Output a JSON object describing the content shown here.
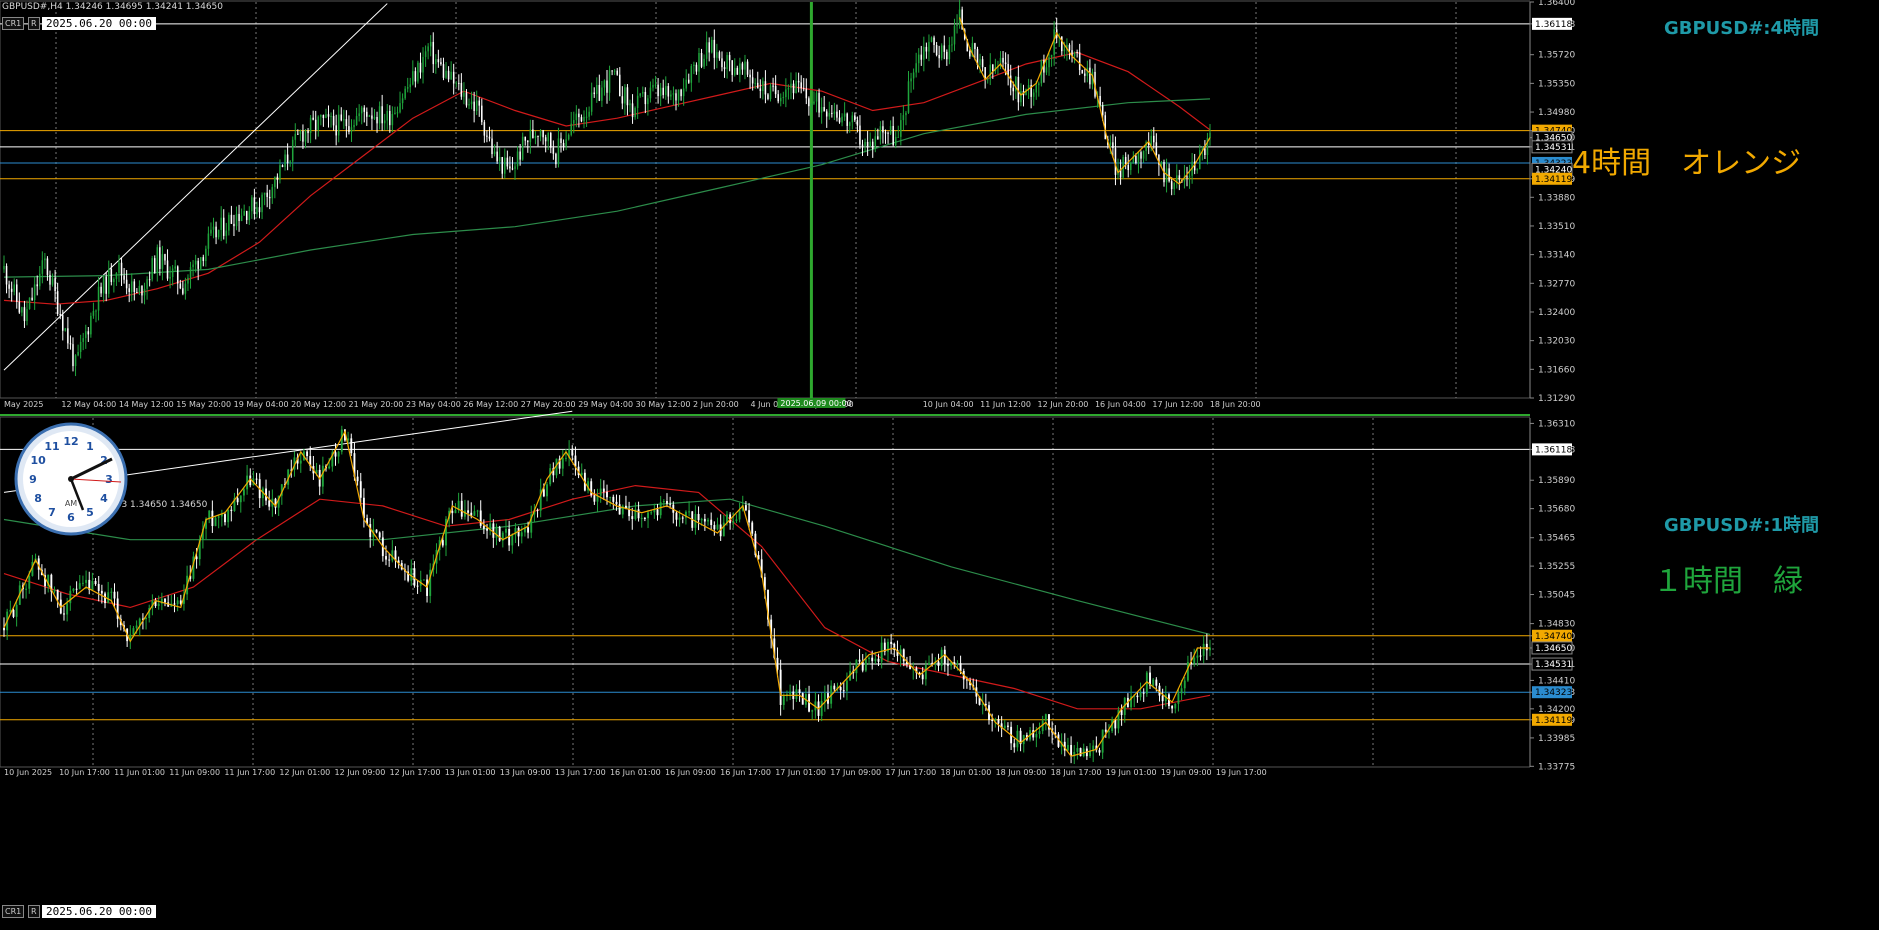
{
  "colors": {
    "background": "#000000",
    "bull": "#1fa53c",
    "bear": "#ffffff",
    "ma_fast": "#d11a1a",
    "ma_slow": "#2c8c4a",
    "zigzag": "#f2a900",
    "orange_level": "#f2a900",
    "blue_level": "#2b8ccf",
    "white_level": "#ffffff",
    "vline_green": "#2ea82e",
    "title": "#1f9aa8"
  },
  "header": {
    "symbol_line": "GBPUSD#,H4  1.34246 1.34695 1.34241 1.34650",
    "symbol_line_bottom": "683 1.34650 1.34650"
  },
  "toolbar": {
    "cr_label": "CR1",
    "r_label": "R",
    "date_value": "2025.06.20 00:00"
  },
  "notes": {
    "h4_note": "4時間　オレンジ",
    "h1_note": "１時間　緑"
  },
  "clock": {
    "am_label": "AM",
    "numbers": [
      "12",
      "1",
      "2",
      "3",
      "4",
      "5",
      "6",
      "7",
      "8",
      "9",
      "10",
      "11"
    ]
  },
  "chart_data": [
    {
      "type": "candlestick",
      "title": "GBPUSD#:4時間",
      "timeframe": "H4",
      "ylim": [
        1.3129,
        1.364
      ],
      "y_ticks": [
        1.364,
        1.36118,
        1.3572,
        1.3535,
        1.3498,
        1.3474,
        1.3465,
        1.34531,
        1.34119,
        1.3388,
        1.3351,
        1.3314,
        1.3277,
        1.324,
        1.3203,
        1.3166,
        1.3129
      ],
      "x_ticks": [
        "May 2025",
        "12 May 04:00",
        "14 May 12:00",
        "15 May 20:00",
        "19 May 04:00",
        "20 May 12:00",
        "21 May 20:00",
        "23 May 04:00",
        "26 May 12:00",
        "27 May 20:00",
        "29 May 04:00",
        "30 May 12:00",
        "2 Jun 20:00",
        "4 Jun 04:00",
        "5 Jun 12:00",
        "2025.06.09 00:00",
        "10 Jun 04:00",
        "11 Jun 12:00",
        "12 Jun 20:00",
        "16 Jun 04:00",
        "17 Jun 12:00",
        "18 Jun 20:00"
      ],
      "horizontal_lines": [
        {
          "price": 1.36118,
          "color": "white"
        },
        {
          "price": 1.3474,
          "color": "orange"
        },
        {
          "price": 1.34531,
          "color": "white"
        },
        {
          "price": 1.34323,
          "color": "blue"
        },
        {
          "price": 1.34119,
          "color": "orange"
        }
      ],
      "price_tags": [
        {
          "label": "1.36118",
          "kind": "white"
        },
        {
          "label": "1.34740",
          "kind": "orange"
        },
        {
          "label": "1.34650",
          "kind": "plain"
        },
        {
          "label": "1.34531",
          "kind": "plain"
        },
        {
          "label": "1.34323",
          "kind": "blue"
        },
        {
          "label": "1.34240",
          "kind": "plain"
        },
        {
          "label": "1.34119",
          "kind": "orange"
        }
      ],
      "vertical_marker": "2025.06.09 00:00",
      "trendline": {
        "from": {
          "bar": 0,
          "price": 1.3165
        },
        "to": {
          "bar": 150,
          "price": 1.3638
        }
      },
      "close_path": [
        [
          0,
          1.3295
        ],
        [
          8,
          1.323
        ],
        [
          16,
          1.3305
        ],
        [
          22,
          1.324
        ],
        [
          28,
          1.317
        ],
        [
          36,
          1.3255
        ],
        [
          44,
          1.33
        ],
        [
          52,
          1.326
        ],
        [
          60,
          1.331
        ],
        [
          70,
          1.3275
        ],
        [
          80,
          1.333
        ],
        [
          90,
          1.3365
        ],
        [
          100,
          1.338
        ],
        [
          108,
          1.342
        ],
        [
          116,
          1.347
        ],
        [
          124,
          1.3485
        ],
        [
          132,
          1.348
        ],
        [
          142,
          1.35
        ],
        [
          150,
          1.349
        ],
        [
          160,
          1.354
        ],
        [
          166,
          1.358
        ],
        [
          172,
          1.355
        ],
        [
          180,
          1.352
        ],
        [
          186,
          1.35
        ],
        [
          192,
          1.344
        ],
        [
          198,
          1.342
        ],
        [
          204,
          1.346
        ],
        [
          210,
          1.348
        ],
        [
          216,
          1.3445
        ],
        [
          222,
          1.348
        ],
        [
          230,
          1.351
        ],
        [
          238,
          1.3545
        ],
        [
          246,
          1.35
        ],
        [
          254,
          1.3525
        ],
        [
          262,
          1.3515
        ],
        [
          270,
          1.356
        ],
        [
          276,
          1.358
        ],
        [
          284,
          1.356
        ],
        [
          292,
          1.3545
        ],
        [
          300,
          1.352
        ],
        [
          308,
          1.3535
        ],
        [
          316,
          1.351
        ],
        [
          324,
          1.3505
        ],
        [
          332,
          1.348
        ],
        [
          338,
          1.345
        ],
        [
          344,
          1.348
        ],
        [
          350,
          1.346
        ],
        [
          356,
          1.356
        ],
        [
          362,
          1.359
        ],
        [
          368,
          1.357
        ],
        [
          374,
          1.362
        ],
        [
          378,
          1.358
        ],
        [
          384,
          1.354
        ],
        [
          390,
          1.356
        ],
        [
          398,
          1.352
        ],
        [
          404,
          1.3535
        ],
        [
          412,
          1.36
        ],
        [
          418,
          1.357
        ],
        [
          426,
          1.3545
        ],
        [
          432,
          1.346
        ],
        [
          436,
          1.342
        ],
        [
          442,
          1.344
        ],
        [
          448,
          1.346
        ],
        [
          454,
          1.342
        ],
        [
          460,
          1.3405
        ],
        [
          466,
          1.343
        ],
        [
          472,
          1.3465
        ]
      ],
      "series": [
        {
          "name": "MA fast",
          "color": "ma_fast",
          "points": [
            [
              0,
              1.3255
            ],
            [
              20,
              1.325
            ],
            [
              40,
              1.3255
            ],
            [
              60,
              1.327
            ],
            [
              80,
              1.329
            ],
            [
              100,
              1.333
            ],
            [
              120,
              1.339
            ],
            [
              140,
              1.344
            ],
            [
              160,
              1.349
            ],
            [
              180,
              1.3525
            ],
            [
              200,
              1.35
            ],
            [
              220,
              1.348
            ],
            [
              240,
              1.349
            ],
            [
              260,
              1.3505
            ],
            [
              280,
              1.352
            ],
            [
              300,
              1.3535
            ],
            [
              320,
              1.3525
            ],
            [
              340,
              1.35
            ],
            [
              360,
              1.351
            ],
            [
              380,
              1.3535
            ],
            [
              400,
              1.356
            ],
            [
              420,
              1.3575
            ],
            [
              440,
              1.355
            ],
            [
              460,
              1.3505
            ],
            [
              472,
              1.3475
            ]
          ]
        },
        {
          "name": "MA slow",
          "color": "ma_slow",
          "points": [
            [
              0,
              1.3285
            ],
            [
              40,
              1.3287
            ],
            [
              80,
              1.3295
            ],
            [
              120,
              1.332
            ],
            [
              160,
              1.334
            ],
            [
              200,
              1.335
            ],
            [
              240,
              1.337
            ],
            [
              280,
              1.34
            ],
            [
              320,
              1.343
            ],
            [
              360,
              1.347
            ],
            [
              400,
              1.3495
            ],
            [
              440,
              1.351
            ],
            [
              472,
              1.3515
            ]
          ]
        }
      ]
    },
    {
      "type": "candlestick",
      "title": "GBPUSD#:1時間",
      "timeframe": "H1",
      "ylim": [
        1.3377,
        1.3635
      ],
      "y_ticks": [
        1.3631,
        1.36118,
        1.3589,
        1.3568,
        1.35465,
        1.35255,
        1.35045,
        1.3483,
        1.3474,
        1.3465,
        1.34531,
        1.3441,
        1.34323,
        1.342,
        1.34119,
        1.33985,
        1.33775
      ],
      "x_ticks": [
        "10 Jun 2025",
        "10 Jun 17:00",
        "11 Jun 01:00",
        "11 Jun 09:00",
        "11 Jun 17:00",
        "12 Jun 01:00",
        "12 Jun 09:00",
        "12 Jun 17:00",
        "13 Jun 01:00",
        "13 Jun 09:00",
        "13 Jun 17:00",
        "16 Jun 01:00",
        "16 Jun 09:00",
        "16 Jun 17:00",
        "17 Jun 01:00",
        "17 Jun 09:00",
        "17 Jun 17:00",
        "18 Jun 01:00",
        "18 Jun 09:00",
        "18 Jun 17:00",
        "19 Jun 01:00",
        "19 Jun 09:00",
        "19 Jun 17:00"
      ],
      "horizontal_lines": [
        {
          "price": 1.36118,
          "color": "white"
        },
        {
          "price": 1.3474,
          "color": "orange"
        },
        {
          "price": 1.34531,
          "color": "white"
        },
        {
          "price": 1.34323,
          "color": "blue"
        },
        {
          "price": 1.34119,
          "color": "orange"
        }
      ],
      "price_tags": [
        {
          "label": "1.36118",
          "kind": "white"
        },
        {
          "label": "1.34740",
          "kind": "orange"
        },
        {
          "label": "1.34650",
          "kind": "plain"
        },
        {
          "label": "1.34531",
          "kind": "plain"
        },
        {
          "label": "1.34323",
          "kind": "blue"
        },
        {
          "label": "1.34119",
          "kind": "orange"
        }
      ],
      "trendline": {
        "from": {
          "bar": 0,
          "price": 1.358
        },
        "to": {
          "bar": 180,
          "price": 1.364
        }
      },
      "close_path": [
        [
          0,
          1.348
        ],
        [
          10,
          1.353
        ],
        [
          18,
          1.3495
        ],
        [
          26,
          1.351
        ],
        [
          34,
          1.35
        ],
        [
          40,
          1.347
        ],
        [
          48,
          1.35
        ],
        [
          56,
          1.3495
        ],
        [
          64,
          1.356
        ],
        [
          70,
          1.3565
        ],
        [
          78,
          1.359
        ],
        [
          86,
          1.357
        ],
        [
          94,
          1.361
        ],
        [
          100,
          1.359
        ],
        [
          108,
          1.3625
        ],
        [
          114,
          1.356
        ],
        [
          120,
          1.354
        ],
        [
          128,
          1.352
        ],
        [
          134,
          1.351
        ],
        [
          142,
          1.357
        ],
        [
          150,
          1.356
        ],
        [
          158,
          1.3545
        ],
        [
          166,
          1.3555
        ],
        [
          172,
          1.359
        ],
        [
          178,
          1.361
        ],
        [
          186,
          1.358
        ],
        [
          194,
          1.357
        ],
        [
          202,
          1.3565
        ],
        [
          210,
          1.357
        ],
        [
          218,
          1.356
        ],
        [
          226,
          1.355
        ],
        [
          234,
          1.357
        ],
        [
          240,
          1.352
        ],
        [
          246,
          1.343
        ],
        [
          252,
          1.343
        ],
        [
          258,
          1.342
        ],
        [
          266,
          1.344
        ],
        [
          274,
          1.346
        ],
        [
          282,
          1.3465
        ],
        [
          290,
          1.3445
        ],
        [
          298,
          1.346
        ],
        [
          306,
          1.344
        ],
        [
          314,
          1.341
        ],
        [
          322,
          1.3395
        ],
        [
          330,
          1.341
        ],
        [
          338,
          1.3385
        ],
        [
          346,
          1.339
        ],
        [
          354,
          1.342
        ],
        [
          362,
          1.344
        ],
        [
          370,
          1.3425
        ],
        [
          378,
          1.3465
        ],
        [
          382,
          1.3465
        ]
      ],
      "series": [
        {
          "name": "MA fast",
          "color": "ma_fast",
          "points": [
            [
              0,
              1.352
            ],
            [
              20,
              1.3505
            ],
            [
              40,
              1.3495
            ],
            [
              60,
              1.351
            ],
            [
              80,
              1.3545
            ],
            [
              100,
              1.3575
            ],
            [
              120,
              1.357
            ],
            [
              140,
              1.3555
            ],
            [
              160,
              1.356
            ],
            [
              180,
              1.3575
            ],
            [
              200,
              1.3585
            ],
            [
              220,
              1.358
            ],
            [
              240,
              1.354
            ],
            [
              260,
              1.348
            ],
            [
              280,
              1.3455
            ],
            [
              300,
              1.3445
            ],
            [
              320,
              1.3435
            ],
            [
              340,
              1.342
            ],
            [
              360,
              1.342
            ],
            [
              382,
              1.343
            ]
          ]
        },
        {
          "name": "MA slow",
          "color": "ma_slow",
          "points": [
            [
              0,
              1.356
            ],
            [
              40,
              1.3545
            ],
            [
              80,
              1.3545
            ],
            [
              120,
              1.3545
            ],
            [
              160,
              1.3555
            ],
            [
              200,
              1.357
            ],
            [
              230,
              1.3575
            ],
            [
              260,
              1.3555
            ],
            [
              300,
              1.3525
            ],
            [
              340,
              1.35
            ],
            [
              382,
              1.3475
            ]
          ]
        }
      ]
    }
  ]
}
